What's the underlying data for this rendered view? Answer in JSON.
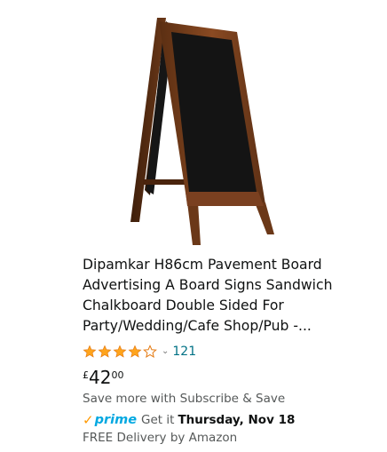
{
  "product": {
    "image_alt": "A-frame chalkboard sandwich board with dark wooden frame",
    "title_lines": [
      "Dipamkar H86cm Pavement Board",
      "Advertising A Board Signs Sandwich",
      "Chalkboard Double Sided For",
      "Party/Wedding/Cafe Shop/Pub -..."
    ],
    "rating": {
      "stars": 4.5,
      "star_color": "#FFA41C",
      "chevron": "⌄",
      "review_count": "121"
    },
    "price": {
      "currency": "£",
      "whole": "42",
      "fraction": "00"
    },
    "subscribe_text": "Save more with Subscribe & Save",
    "prime": {
      "check": "✓",
      "label": "prime",
      "get_it": "Get it",
      "date": "Thursday, Nov 18"
    },
    "free_delivery": "FREE Delivery by Amazon"
  },
  "colors": {
    "link": "#007185",
    "prime_blue": "#00A8E1",
    "prime_orange": "#FF9900",
    "secondary_text": "#565959"
  }
}
